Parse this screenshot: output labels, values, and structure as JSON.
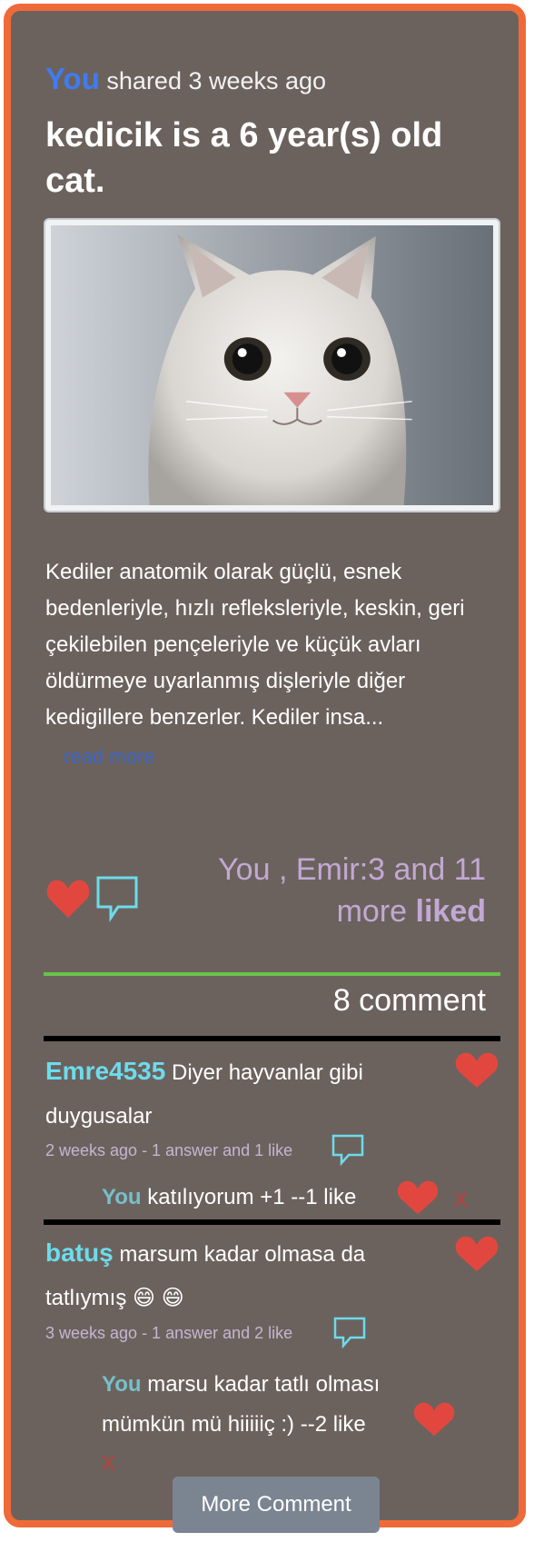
{
  "post": {
    "author": "You",
    "shared_text": "shared 3 weeks ago",
    "title": "kedicik is a 6 year(s) old cat.",
    "description": "Kediler anatomik olarak güçlü, esnek bedenleriyle, hızlı refleksleriyle, keskin, geri çekilebilen pençeleriyle ve küçük avları öldürmeye uyarlanmış dişleriyle diğer kedigillere benzerler. Kediler insa...",
    "read_more": "read more",
    "likes_line1": "You , Emir:3 and 11",
    "likes_line2": "more",
    "likes_word": "liked",
    "comment_count": "8 comment"
  },
  "comments": [
    {
      "user": "Emre4535",
      "text": "Diyer hayvanlar gibi duygusalar",
      "meta": "2 weeks ago - 1 answer and 1 like",
      "reply": {
        "user": "You",
        "text": "katılıyorum +1 --1 like",
        "delete": "X"
      }
    },
    {
      "user": "batuş",
      "text": "marsum kadar olmasa da tatlıymış 😄 😄",
      "meta": "3 weeks ago - 1 answer and 2 like",
      "reply": {
        "user": "You",
        "text": "marsu kadar tatlı olması mümkün mü hiiiiiç :) --2 like",
        "delete": "X"
      }
    }
  ],
  "more_comment": "More Comment",
  "colors": {
    "card_bg": "#6c625d",
    "border": "#ee6a38",
    "heart": "#e2473f",
    "accent_blue": "#3f7cf0",
    "username": "#6cdcec",
    "likes_text": "#c2a8d4",
    "divider_green": "#6ac24a"
  },
  "icons": [
    "heart-icon",
    "comment-bubble-icon"
  ]
}
